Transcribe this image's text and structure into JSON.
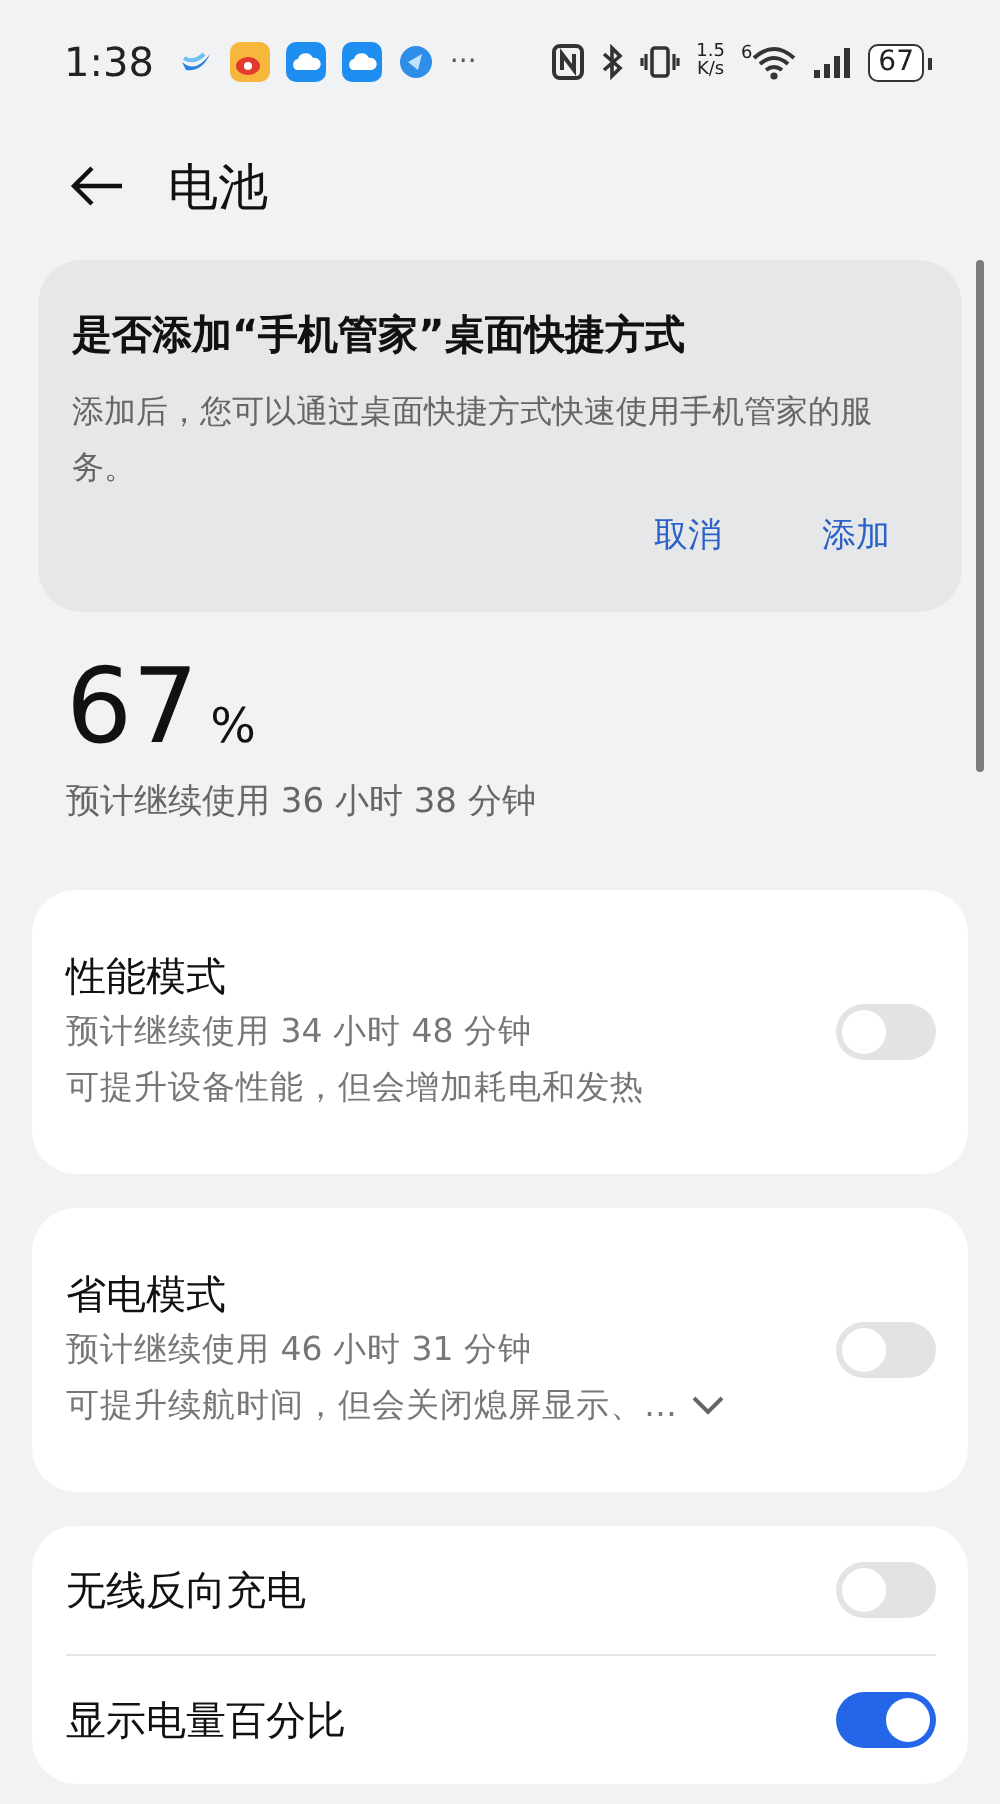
{
  "status_bar": {
    "time": "1:38",
    "more": "···",
    "speed_value": "1.5",
    "speed_unit": "K/s",
    "wifi_badge": "6",
    "battery": "67"
  },
  "header": {
    "title": "电池"
  },
  "dialog": {
    "title": "是否添加“手机管家”桌面快捷方式",
    "message": "添加后，您可以通过桌面快捷方式快速使用手机管家的服务。",
    "buttons": [
      "取消",
      "添加"
    ]
  },
  "battery": {
    "percent": "67",
    "unit": "%",
    "estimate": "预计继续使用 36 小时 38 分钟"
  },
  "groups": [
    {
      "items": [
        {
          "kind": "mode",
          "title": "性能模式",
          "estimate": "预计继续使用 34 小时 48 分钟",
          "description": "可提升设备性能，但会增加耗电和发热",
          "on": false
        }
      ]
    },
    {
      "items": [
        {
          "kind": "mode",
          "title": "省电模式",
          "estimate": "预计继续使用 46 小时 31 分钟",
          "description": "可提升续航时间，但会关闭熄屏显示、…",
          "expanded": false,
          "on": false
        }
      ]
    },
    {
      "items": [
        {
          "kind": "simple",
          "title": "无线反向充电",
          "on": false
        },
        {
          "kind": "simple",
          "title": "显示电量百分比",
          "on": true
        }
      ]
    }
  ]
}
